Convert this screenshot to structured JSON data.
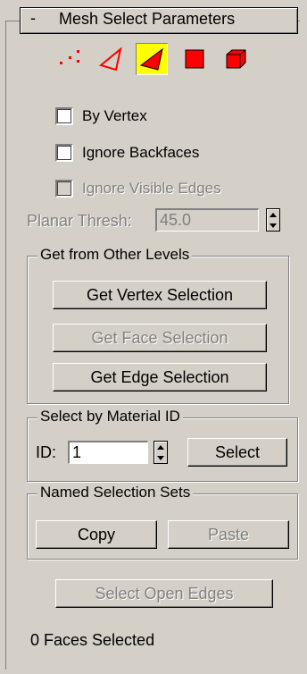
{
  "rollout": {
    "toggle": "-",
    "title": "Mesh Select Parameters"
  },
  "sub_object_levels": [
    {
      "name": "vertex-icon",
      "active": false
    },
    {
      "name": "edge-icon",
      "active": false
    },
    {
      "name": "face-icon",
      "active": true
    },
    {
      "name": "polygon-icon",
      "active": false
    },
    {
      "name": "element-icon",
      "active": false
    }
  ],
  "options": {
    "by_vertex": "By Vertex",
    "ignore_backfaces": "Ignore Backfaces",
    "ignore_visible_edges": "Ignore Visible Edges",
    "planar_thresh_label": "Planar Thresh:",
    "planar_thresh_value": "45.0"
  },
  "get_from_other_levels": {
    "title": "Get from Other Levels",
    "vertex_button": "Get Vertex Selection",
    "face_button": "Get Face Selection",
    "edge_button": "Get Edge Selection"
  },
  "select_by_material": {
    "title": "Select by Material ID",
    "id_label": "ID:",
    "id_value": "1",
    "select_button": "Select"
  },
  "named_sets": {
    "title": "Named Selection Sets",
    "copy_button": "Copy",
    "paste_button": "Paste"
  },
  "select_open_edges_button": "Select Open Edges",
  "status": "0 Faces Selected",
  "colors": {
    "icon_red": "#ff0000",
    "active_highlight": "#ffff00",
    "panel_bg": "#d4d0c8"
  }
}
